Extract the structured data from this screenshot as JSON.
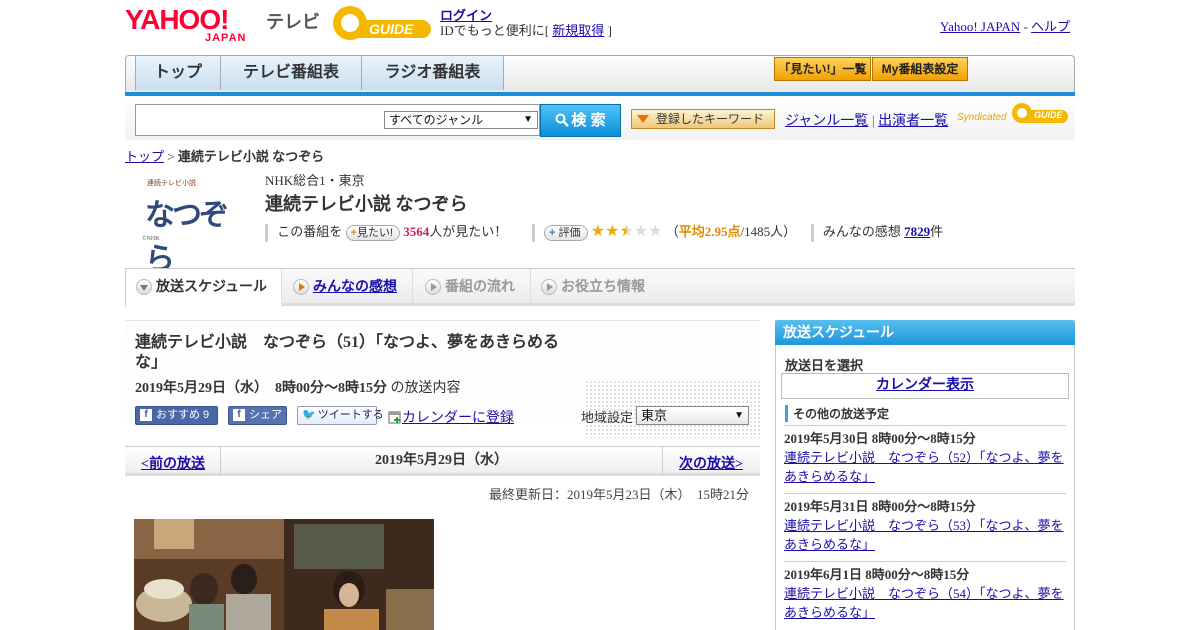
{
  "header": {
    "yahoo_logo": "YAHOO!",
    "japan_logo": "JAPAN",
    "tv_label": "テレビ",
    "gguide_logo": "GUIDE",
    "login": "ログイン",
    "id_prefix": "IDでもっと便利に[",
    "signup": "新規取得",
    "id_suffix": "]",
    "yahoo_japan_link": "Yahoo! JAPAN",
    "separator": "-",
    "help_link": "ヘルプ"
  },
  "nav": {
    "tabs": [
      "トップ",
      "テレビ番組表",
      "ラジオ番組表"
    ],
    "mitai_list": "「見たい!」一覧",
    "my_schedule": "My番組表設定"
  },
  "search": {
    "genre_selected": "すべてのジャンル",
    "button": "検 索",
    "keyword_button": "登録したキーワード",
    "genre_list": "ジャンル一覧",
    "divider": "|",
    "performer_list": "出演者一覧",
    "syndicated": "Syndicated",
    "synd_logo": "GUIDE"
  },
  "breadcrumb": {
    "top": "トップ",
    "sep": ">",
    "current": "連続テレビ小説 なつぞら"
  },
  "program": {
    "channel": "NHK総合1・東京",
    "title": "連続テレビ小説 なつぞら",
    "thumb_text": "なつぞら",
    "thumb_small": "連続テレビ小説",
    "thumb_copyright": "©NHK",
    "want_prefix": "この番組を",
    "want_button": "見たい!",
    "want_count": "3564",
    "want_suffix": "人が見たい！",
    "rate_button": "評価",
    "rating_stars": 2.95,
    "avg_open": "（",
    "avg_label": "平均2.95点",
    "avg_count": "/1485人）",
    "impressions_label": "みんなの感想",
    "impressions_count": "7829",
    "impressions_suffix": "件"
  },
  "subtabs": [
    "放送スケジュール",
    "みんなの感想",
    "番組の流れ",
    "お役立ち情報"
  ],
  "episode": {
    "title": "連続テレビ小説　なつぞら（51）「なつよ、夢をあきらめるな」",
    "date": "2019年5月29日（水）　8時00分～8時15分",
    "date_suffix": "の放送内容",
    "recommend": "おすすめ 9",
    "share": "シェア",
    "tweet": "ツイートする",
    "calendar_register": "カレンダーに登録",
    "region_label": "地域設定",
    "region_selected": "東京"
  },
  "pager": {
    "prev": "<前の放送",
    "current_date": "2019年5月29日（水）",
    "next": "次の放送>"
  },
  "updated": "最終更新日：2019年5月23日（木）　15時21分",
  "side": {
    "header": "放送スケジュール",
    "select_day": "放送日を選択",
    "calendar": "カレンダー表示",
    "other_header": "その他の放送予定",
    "items": [
      {
        "time": "2019年5月30日  8時00分～8時15分",
        "title": "連続テレビ小説　なつぞら（52）「なつよ、夢をあきらめるな」"
      },
      {
        "time": "2019年5月31日  8時00分～8時15分",
        "title": "連続テレビ小説　なつぞら（53）「なつよ、夢をあきらめるな」"
      },
      {
        "time": "2019年6月1日  8時00分～8時15分",
        "title": "連続テレビ小説　なつぞら（54）「なつよ、夢をあきらめるな」"
      }
    ]
  },
  "colors": {
    "yahoo_red": "#ff0033",
    "gguide_yellow": "#f5b700",
    "nav_blue": "#1a8fd8",
    "link": "#1a0dab",
    "want_pink": "#d81b60",
    "star": "#f2a900"
  }
}
